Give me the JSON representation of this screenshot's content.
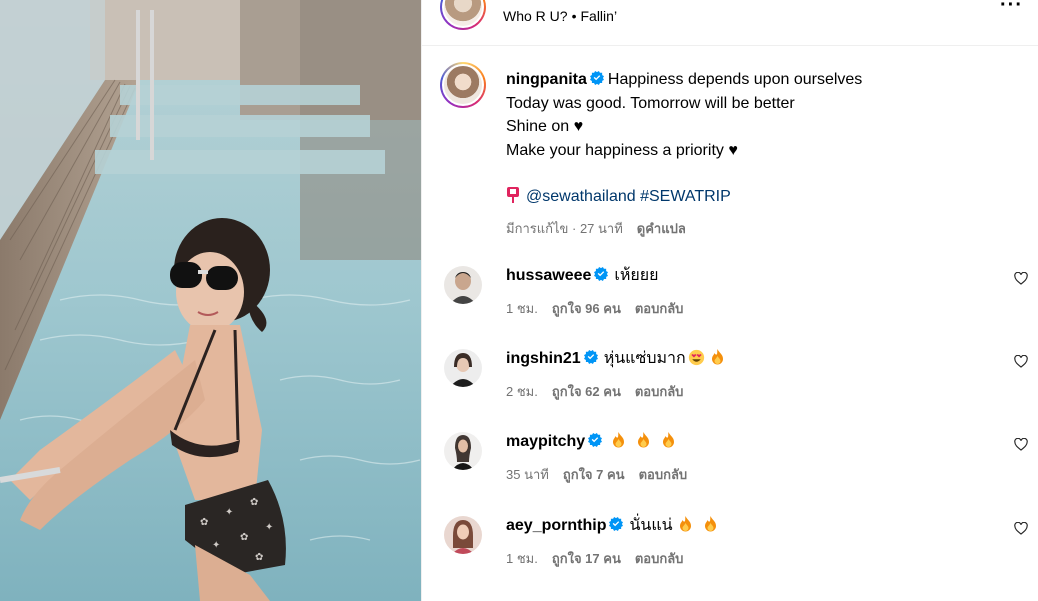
{
  "media": {
    "description_icon": "video-frame"
  },
  "header": {
    "audio_artist": "Who R U?",
    "audio_separator": "•",
    "audio_track": "Fallin’",
    "more_icon": "more-icon"
  },
  "caption": {
    "username": "ningpanita",
    "lines": [
      "Happiness depends upon ourselves",
      "Today was good. Tomorrow will be better",
      "Shine on ♥",
      "Make your happiness a priority ♥"
    ],
    "mention": "@sewathailand",
    "hashtag": "#SEWATRIP",
    "edited": "มีการแก้ไข · 27 นาที",
    "translate": "ดูคำแปล"
  },
  "comments": [
    {
      "username": "hussaweee",
      "text": "เห้ยยย",
      "fires": 0,
      "heart_eyes": false,
      "time": "1 ชม.",
      "likes": "ถูกใจ 96 คน",
      "reply": "ตอบกลับ"
    },
    {
      "username": "ingshin21",
      "text": "หุ่นแซ่บมาก",
      "fires": 1,
      "heart_eyes": true,
      "time": "2 ชม.",
      "likes": "ถูกใจ 62 คน",
      "reply": "ตอบกลับ"
    },
    {
      "username": "maypitchy",
      "text": "",
      "fires": 3,
      "heart_eyes": false,
      "time": "35 นาที",
      "likes": "ถูกใจ 7 คน",
      "reply": "ตอบกลับ"
    },
    {
      "username": "aey_pornthip",
      "text": "นั่นแน่",
      "fires": 2,
      "heart_eyes": false,
      "time": "1 ชม.",
      "likes": "ถูกใจ 17 คน",
      "reply": "ตอบกลับ"
    }
  ],
  "colors": {
    "link": "#00376b",
    "verified": "#0095f6",
    "secondary": "#737373"
  }
}
